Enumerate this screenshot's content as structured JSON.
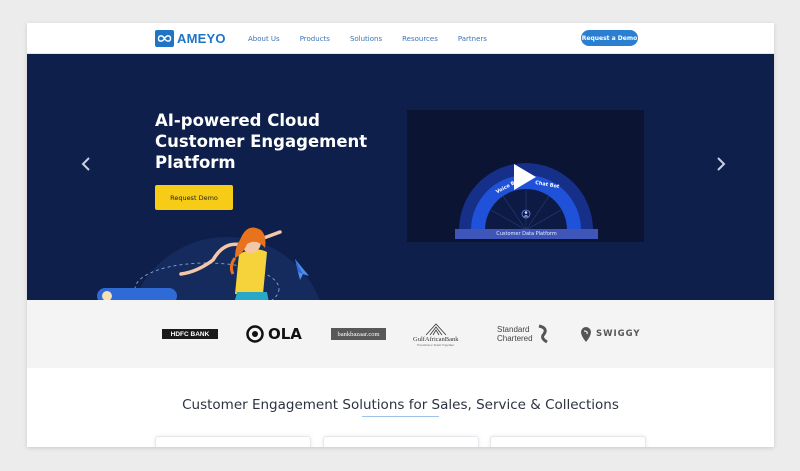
{
  "header": {
    "logo_text": "AMEYO",
    "nav": [
      "About Us",
      "Products",
      "Solutions",
      "Resources",
      "Partners"
    ],
    "cta": "Request a Demo"
  },
  "hero": {
    "title_lines": [
      "AI-powered Cloud",
      "Customer Engagement",
      "Platform"
    ],
    "cta": "Request Demo",
    "video": {
      "arc_label_left": "Voice Bo",
      "arc_label_right": "Chat Bot",
      "platform_label": "Customer Data Platform"
    }
  },
  "clients": {
    "hdfc": "HDFC BANK",
    "ola": "OLA",
    "bankbazaar": "bankbazaar.com",
    "gulf_name": "GulfAfricanBank",
    "gulf_tagline": "Excellence Team Together",
    "standard_chartered_line1": "Standard",
    "standard_chartered_line2": "Chartered",
    "swiggy": "SWIGGY"
  },
  "section": {
    "title": "Customer Engagement Solutions for Sales, Service & Collections"
  },
  "colors": {
    "brand_blue": "#1f74c6",
    "hero_bg": "#0f1f4b",
    "cta_yellow": "#f6cc16"
  },
  "icons": [
    "infinity-logo-icon",
    "chevron-left-icon",
    "chevron-right-icon",
    "play-icon",
    "paper-plane-icon"
  ]
}
